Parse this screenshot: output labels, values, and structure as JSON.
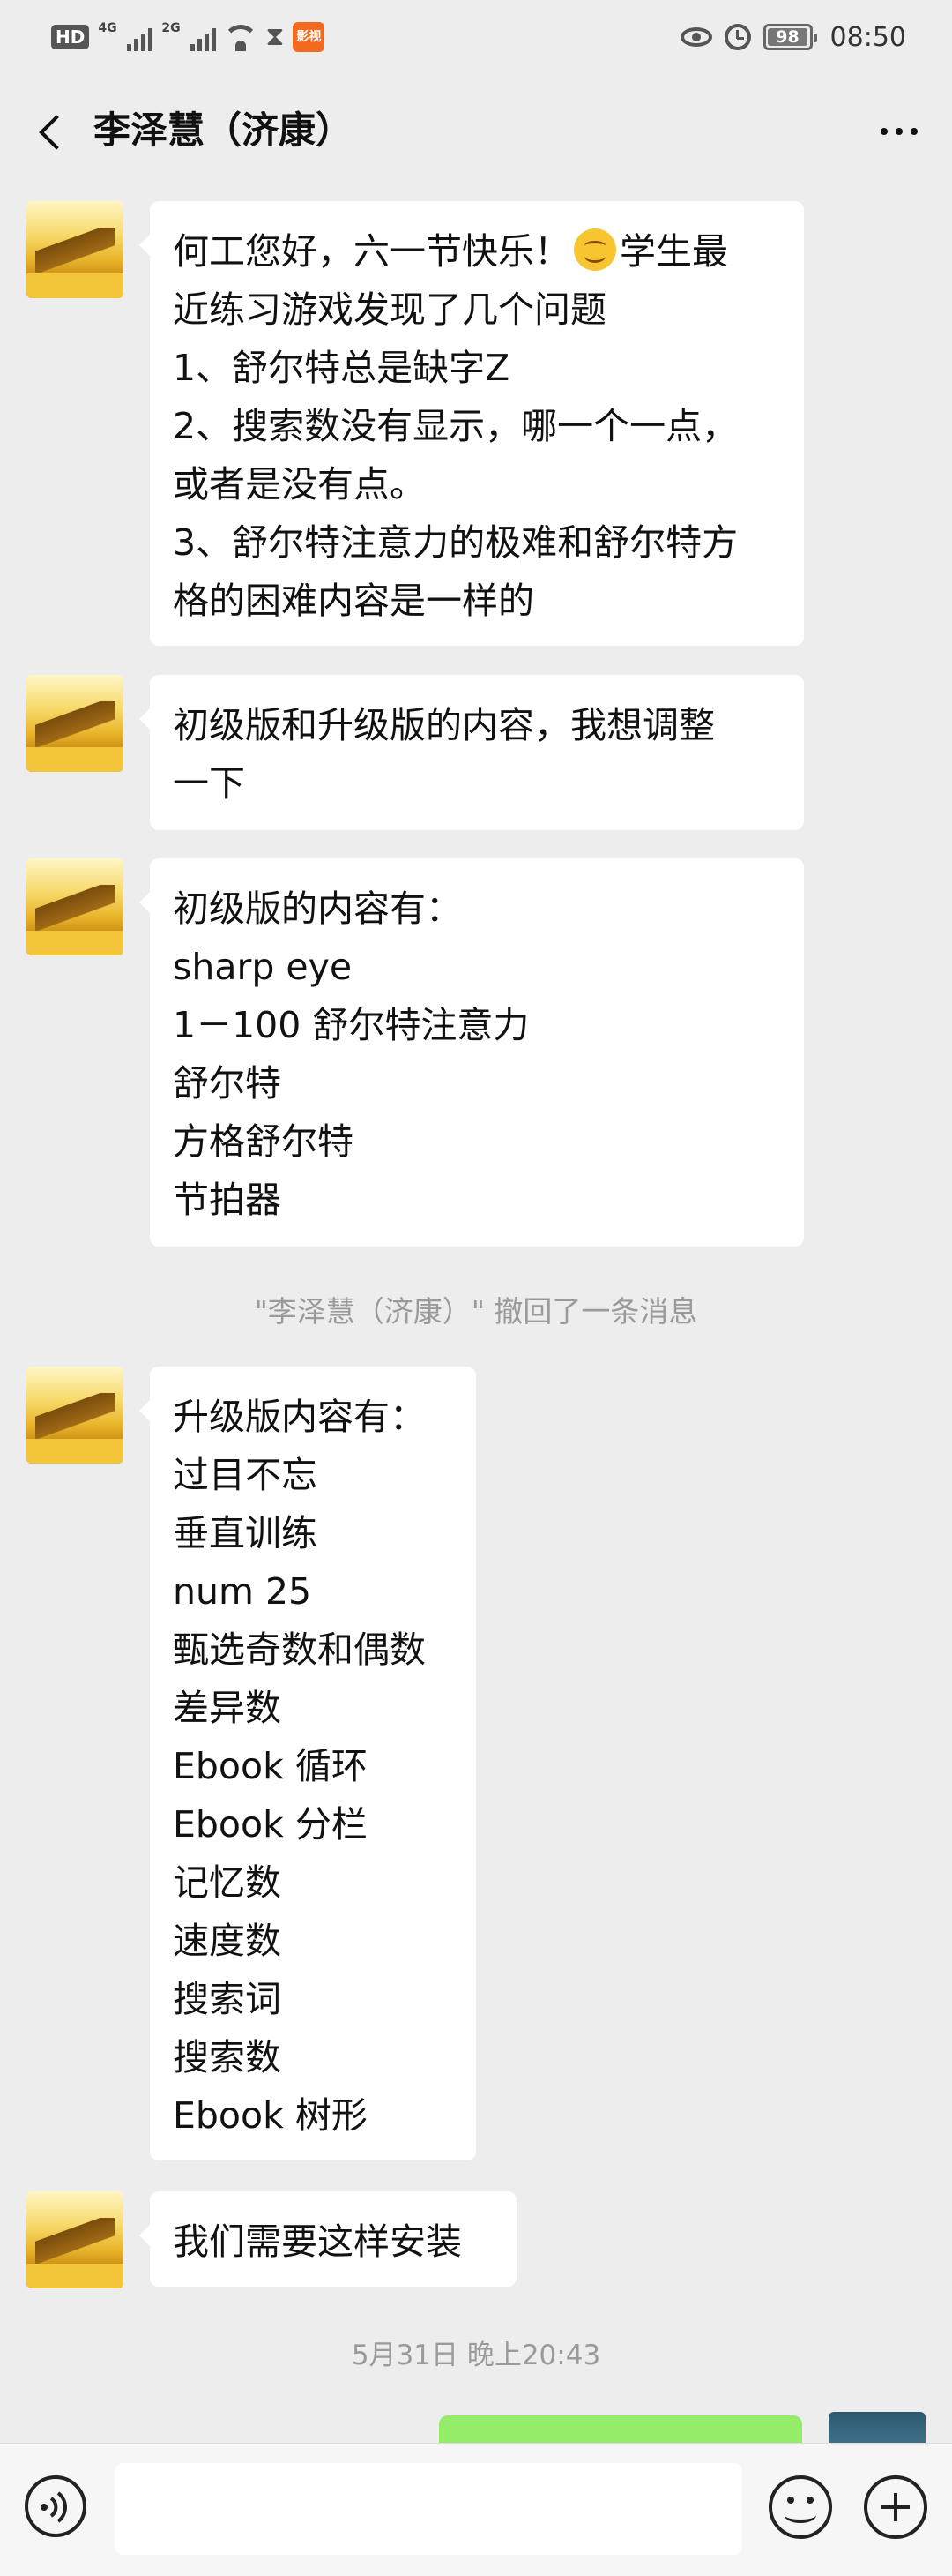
{
  "status_bar": {
    "chip": "HD",
    "net1": "4G",
    "net2": "2G",
    "app_label": "影视",
    "battery_percent": "98",
    "time": "08:50"
  },
  "header": {
    "title": "李泽慧（济康）"
  },
  "messages": [
    {
      "line1_before_emoji": "何工您好，六一节快乐！",
      "emoji": "smiling-face",
      "line1_after_emoji": "学生最",
      "rest": "近练习游戏发现了几个问题\n1、舒尔特总是缺字Z\n2、搜索数没有显示，哪一个一点，\n或者是没有点。\n3、舒尔特注意力的极难和舒尔特方\n格的困难内容是一样的"
    },
    {
      "text": "初级版和升级版的内容，我想调整\n一下"
    },
    {
      "text": "初级版的内容有：\nsharp eye\n1－100 舒尔特注意力\n舒尔特\n方格舒尔特\n节拍器"
    },
    {
      "text": "升级版内容有：\n过目不忘\n垂直训练\nnum 25\n甄选奇数和偶数\n差异数\nEbook 循环\nEbook 分栏\n记忆数\n速度数\n搜索词\n搜索数\nEbook 树形"
    },
    {
      "text": "我们需要这样安装"
    }
  ],
  "system_notice": "\"李泽慧（济康）\" 撤回了一条消息",
  "timestamp": "5月31日 晚上20:43",
  "input_bar": {
    "placeholder": ""
  }
}
